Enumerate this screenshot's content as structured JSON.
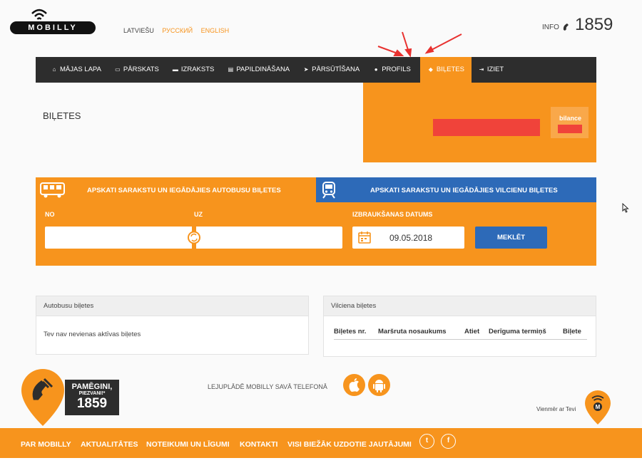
{
  "header": {
    "logo_text": "MOBILLY",
    "langs": [
      "LATVIEŠU",
      "РУССКИЙ",
      "ENGLISH"
    ],
    "info_label": "INFO",
    "phone": "1859"
  },
  "nav": {
    "items": [
      {
        "label": "MĀJAS LAPA",
        "icon": "home-icon",
        "glyph": "⌂"
      },
      {
        "label": "PĀRSKATS",
        "icon": "monitor-icon",
        "glyph": "▭"
      },
      {
        "label": "IZRAKSTS",
        "icon": "folder-icon",
        "glyph": "▬"
      },
      {
        "label": "PAPILDINĀŠANA",
        "icon": "card-icon",
        "glyph": "▤"
      },
      {
        "label": "PĀRSŪTĪŠANA",
        "icon": "send-icon",
        "glyph": "➤"
      },
      {
        "label": "PROFILS",
        "icon": "user-icon",
        "glyph": "●"
      },
      {
        "label": "BIĻETES",
        "icon": "ticket-icon",
        "glyph": "◆"
      },
      {
        "label": "IZIET",
        "icon": "logout-icon",
        "glyph": "⇥"
      }
    ]
  },
  "page": {
    "title": "BIĻETES",
    "balance_label": "bilance"
  },
  "search": {
    "bus_tab": "APSKATI SARAKSTU UN IEGĀDĀJIES AUTOBUSU BIĻETES",
    "train_tab": "APSKATI SARAKSTU UN IEGĀDĀJIES VILCIENU BIĻETES",
    "from_label": "NO",
    "to_label": "UZ",
    "date_label": "IZBRAUKŠANAS DATUMS",
    "date_value": "09.05.2018",
    "search_button": "MEKLĒT"
  },
  "bus_card": {
    "title": "Autobusu biļetes",
    "empty": "Tev nav nevienas aktīvas biļetes"
  },
  "train_card": {
    "title": "Vilciena biļetes",
    "columns": [
      "Biļetes nr.",
      "Maršruta nosaukums",
      "Atiet",
      "Derīguma termiņš",
      "Biļete"
    ]
  },
  "promo": {
    "line1": "PAMĒGINI,",
    "line2": "PIEZVANI!*",
    "number": "1859",
    "download": "LEJUPLĀDĒ MOBILLY SAVĀ TELEFONĀ",
    "slogan": "Vienmēr ar Tevi"
  },
  "footer": {
    "links": [
      "PAR MOBILLY",
      "AKTUALITĀTES",
      "NOTEIKUMI UN LĪGUMI",
      "KONTAKTI",
      "VISI BIEŽĀK UZDOTIE JAUTĀJUMI"
    ],
    "twitter": "t",
    "facebook": "f"
  },
  "colors": {
    "orange": "#f7941d",
    "blue": "#2d6ab8",
    "dark": "#2d2d2d",
    "red": "#f0433a"
  }
}
